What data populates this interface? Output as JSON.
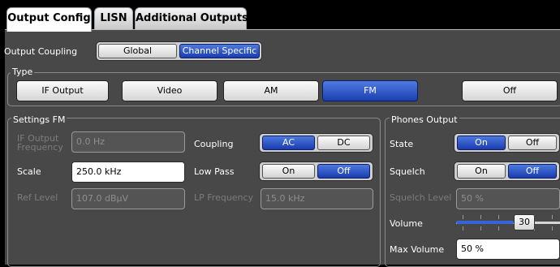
{
  "tabs": [
    {
      "label": "Output Config",
      "active": true
    },
    {
      "label": "LISN",
      "active": false
    },
    {
      "label": "Additional Outputs",
      "active": false
    }
  ],
  "coupling": {
    "label": "Output Coupling",
    "options": [
      "Global",
      "Channel Specific"
    ],
    "selected": "Channel Specific"
  },
  "type": {
    "title": "Type",
    "options": [
      "IF Output",
      "Video",
      "AM",
      "FM",
      "Off"
    ],
    "selected": "FM"
  },
  "settings": {
    "title": "Settings FM",
    "if_output_label_line1": "IF Output",
    "if_output_label_line2": "Frequency",
    "if_output_value": "0.0 Hz",
    "scale_label": "Scale",
    "scale_value": "250.0 kHz",
    "ref_level_label": "Ref Level",
    "ref_level_value": "107.0 dBµV",
    "coupling_label": "Coupling",
    "coupling_options": [
      "AC",
      "DC"
    ],
    "coupling_selected": "AC",
    "lowpass_label": "Low Pass",
    "lowpass_options": [
      "On",
      "Off"
    ],
    "lowpass_selected": "Off",
    "lp_freq_label": "LP Frequency",
    "lp_freq_value": "15.0 kHz"
  },
  "phones": {
    "title": "Phones Output",
    "state_label": "State",
    "state_options": [
      "On",
      "Off"
    ],
    "state_selected": "On",
    "squelch_label": "Squelch",
    "squelch_options": [
      "On",
      "Off"
    ],
    "squelch_selected": "Off",
    "squelch_level_label": "Squelch Level",
    "squelch_level_value": "50 %",
    "volume_label": "Volume",
    "volume_value": "30",
    "volume_fraction": 0.3,
    "max_volume_label": "Max Volume",
    "max_volume_value": "50 %"
  },
  "colors": {
    "selected": "#1c3fb0",
    "background": "#484848",
    "disabled_text": "#7c7c7c"
  }
}
